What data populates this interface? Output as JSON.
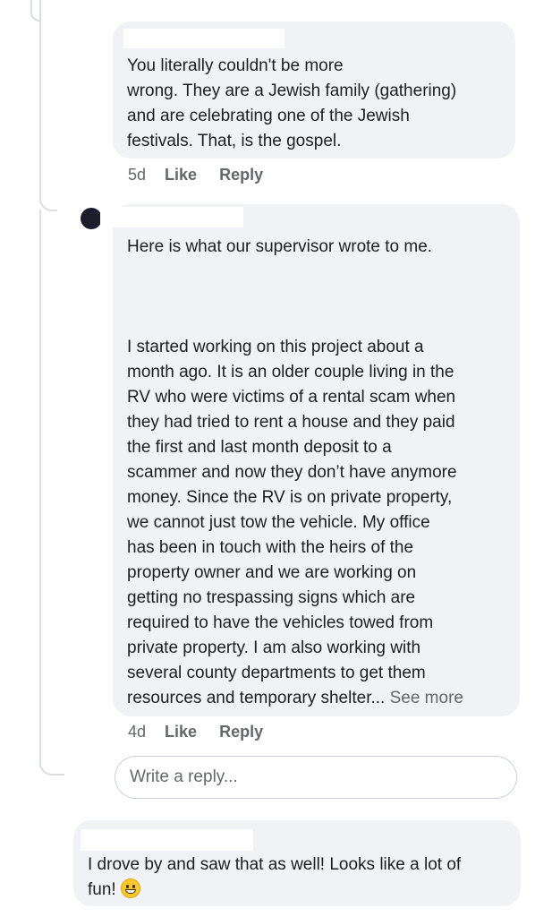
{
  "comments": [
    {
      "text": "You literally couldn't be more\nwrong. They are a Jewish family (gathering)\nand are celebrating one of the Jewish\nfestivals. That, is the gospel.",
      "time": "5d",
      "like_label": "Like",
      "reply_label": "Reply"
    },
    {
      "text": "Here is what our supervisor wrote to me.\n\n\n\nI started working on this project about a\nmonth ago. It is an older couple living in the\nRV who were victims of a rental scam when\nthey had tried to rent a house and they paid\nthe first and last month deposit to a\nscammer and now they don’t have anymore\nmoney. Since the RV is on private property,\nwe cannot just tow the vehicle. My office\nhas been in touch with the heirs of the\nproperty owner and we are working on\ngetting no trespassing signs which are\nrequired to have the vehicles towed from\nprivate property. I am also working with\nseveral county departments to get them\nresources and temporary shelter...",
      "see_more": "See more",
      "time": "4d",
      "like_label": "Like",
      "reply_label": "Reply"
    },
    {
      "text": "I drove by and saw that as well! Looks like a lot of\nfun!"
    }
  ],
  "reply_placeholder": "Write a reply...",
  "emoji": "grinning-face"
}
